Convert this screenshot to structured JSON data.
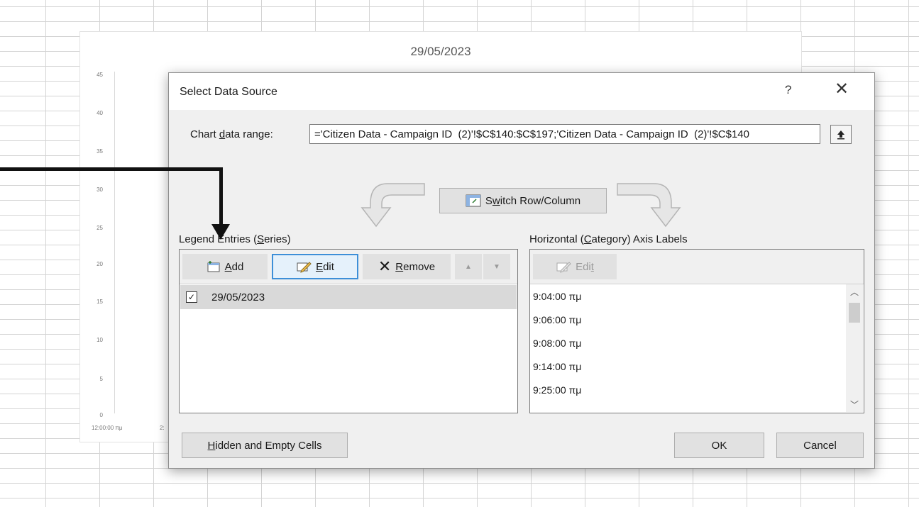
{
  "chart": {
    "title": "29/05/2023",
    "y_ticks": [
      "45",
      "40",
      "35",
      "30",
      "25",
      "20",
      "15",
      "10",
      "5",
      "0"
    ],
    "x_ticks": [
      "12:00:00 πμ",
      "2:"
    ]
  },
  "dialog": {
    "title": "Select Data Source",
    "help": "?",
    "close": "✕",
    "range_label_pre": "Chart ",
    "range_label_ul": "d",
    "range_label_post": "ata range:",
    "range_value": "='Citizen Data - Campaign ID  (2)'!$C$140:$C$197;'Citizen Data - Campaign ID  (2)'!$C$140",
    "switch_pre": "S",
    "switch_ul": "w",
    "switch_post": "itch Row/Column",
    "legend": {
      "label_pre": "Legend Entries (",
      "label_ul": "S",
      "label_post": "eries)",
      "add_ul": "A",
      "add_rest": "dd",
      "edit_ul": "E",
      "edit_rest": "dit",
      "remove_ul": "R",
      "remove_rest": "emove",
      "entry": "29/05/2023"
    },
    "axis": {
      "label_pre": "Horizontal (",
      "label_ul": "C",
      "label_post": "ategory) Axis Labels",
      "edit_pre": "Edi",
      "edit_ul": "t",
      "items": [
        "9:04:00 πμ",
        "9:06:00 πμ",
        "9:08:00 πμ",
        "9:14:00 πμ",
        "9:25:00 πμ"
      ]
    },
    "hidden_ul": "H",
    "hidden_rest": "idden and Empty Cells",
    "ok": "OK",
    "cancel": "Cancel"
  }
}
